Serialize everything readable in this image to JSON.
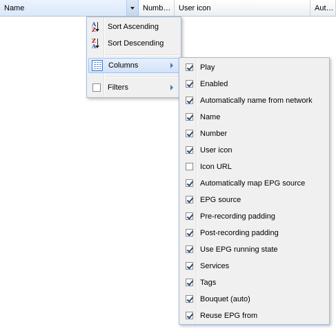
{
  "grid": {
    "columns": [
      {
        "label": "Name",
        "active": true
      },
      {
        "label": "Numb…",
        "active": false
      },
      {
        "label": "User icon",
        "active": false
      },
      {
        "label": "Aut…",
        "active": false
      }
    ]
  },
  "column_menu": {
    "sort_ascending": "Sort Ascending",
    "sort_descending": "Sort Descending",
    "columns": "Columns",
    "filters": "Filters",
    "filters_checked": false,
    "sort_icon_letters": {
      "asc": [
        "A",
        "Z"
      ],
      "desc": [
        "Z",
        "A"
      ]
    }
  },
  "columns_submenu": {
    "items": [
      {
        "label": "Play",
        "checked": true
      },
      {
        "label": "Enabled",
        "checked": true
      },
      {
        "label": "Automatically name from network",
        "checked": true
      },
      {
        "label": "Name",
        "checked": true
      },
      {
        "label": "Number",
        "checked": true
      },
      {
        "label": "User icon",
        "checked": true
      },
      {
        "label": "Icon URL",
        "checked": false
      },
      {
        "label": "Automatically map EPG source",
        "checked": true
      },
      {
        "label": "EPG source",
        "checked": true
      },
      {
        "label": "Pre-recording padding",
        "checked": true
      },
      {
        "label": "Post-recording padding",
        "checked": true
      },
      {
        "label": "Use EPG running state",
        "checked": true
      },
      {
        "label": "Services",
        "checked": true
      },
      {
        "label": "Tags",
        "checked": true
      },
      {
        "label": "Bouquet (auto)",
        "checked": true
      },
      {
        "label": "Reuse EPG from",
        "checked": true
      }
    ]
  },
  "colors": {
    "menu_border": "#a3bad9",
    "active_item": "#d2e2f7",
    "check": "#2d4a7a"
  }
}
